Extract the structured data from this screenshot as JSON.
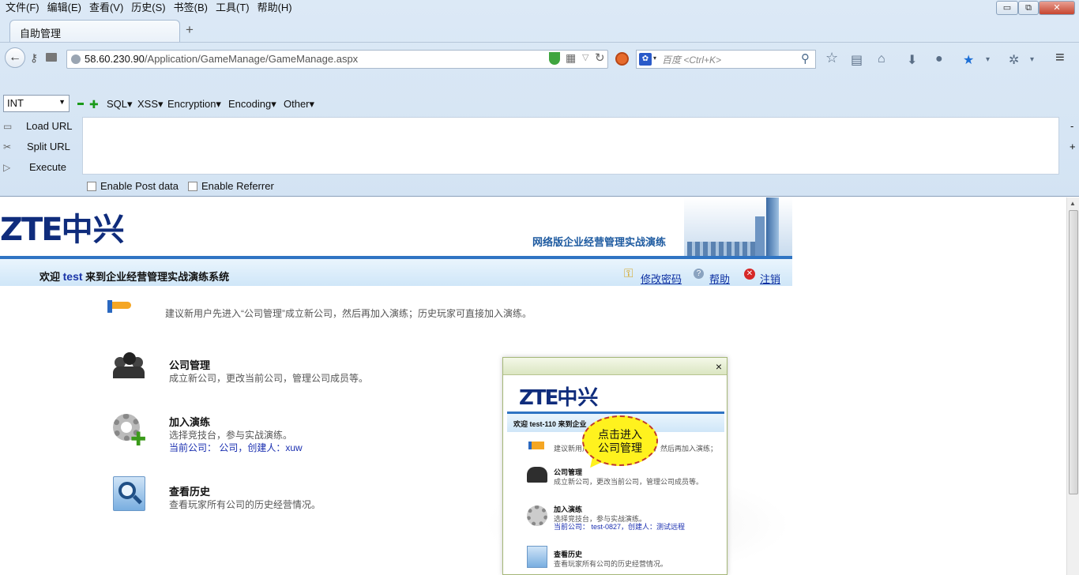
{
  "menu": [
    "文件(F)",
    "编辑(E)",
    "查看(V)",
    "历史(S)",
    "书签(B)",
    "工具(T)",
    "帮助(H)"
  ],
  "window_buttons": {
    "minimize": "▭",
    "restore": "⧉",
    "close": "✕"
  },
  "tab": {
    "title": "自助管理",
    "new_tab": "+"
  },
  "nav": {
    "back": "←",
    "url_host": "58.60.230.90",
    "url_path": "/Application/GameManage/GameManage.aspx",
    "search_placeholder": "百度 <Ctrl+K>",
    "search_engine_icon": "paw-icon"
  },
  "hackbar": {
    "type_select": "INT",
    "menus": [
      "SQL▾",
      "XSS▾",
      "Encryption▾",
      "Encoding▾",
      "Other▾"
    ],
    "load_url": "Load URL",
    "split_url": "Split URL",
    "execute": "Execute",
    "enable_post": "Enable Post data",
    "enable_referrer": "Enable Referrer",
    "minus": "-",
    "plus": "+"
  },
  "page": {
    "logo_latin": "ZTE",
    "logo_cn": "中兴",
    "banner_title": "网络版企业经营管理实战演练",
    "welcome_prefix": "欢迎",
    "welcome_user": "test",
    "welcome_suffix": "来到企业经营管理实战演练系统",
    "change_password": "修改密码",
    "help": "帮助",
    "logout": "注销",
    "tip": "建议新用户先进入“公司管理”成立新公司，然后再加入演练；历史玩家可直接加入演练。",
    "items": [
      {
        "title": "公司管理",
        "desc": "成立新公司，更改当前公司，管理公司成员等。"
      },
      {
        "title": "加入演练",
        "desc": "选择竞技台，参与实战演练。",
        "current_label": "当前公司：",
        "current_value": "公司，创建人：xuw"
      },
      {
        "title": "查看历史",
        "desc": "查看玩家所有公司的历史经营情况。"
      }
    ]
  },
  "popup": {
    "close": "×",
    "welcome": "欢迎 test-110 来到企业",
    "tip": "建议新用户",
    "tip_end": "，然后再加入演练；",
    "bubble": "点击进入公司管理",
    "items": [
      {
        "title": "公司管理",
        "desc": "成立新公司，更改当前公司，管理公司成员等。"
      },
      {
        "title": "加入演练",
        "desc": "选择竞技台，参与实战演练。",
        "current": "当前公司： test-0827，创建人：测试远程"
      },
      {
        "title": "查看历史",
        "desc": "查看玩家所有公司的历史经营情况。"
      }
    ]
  },
  "colors": {
    "accent": "#2f74c3",
    "link": "#0c2fa2",
    "logo": "#0f2c7c"
  }
}
